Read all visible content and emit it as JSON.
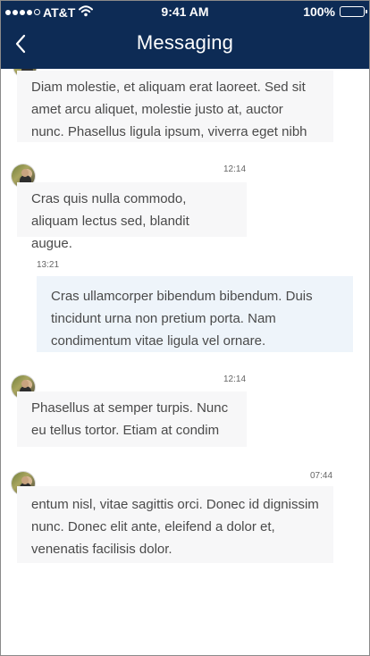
{
  "status_bar": {
    "carrier": "AT&T",
    "time": "9:41 AM",
    "battery_text": "100%",
    "battery_level": 1
  },
  "header": {
    "title": "Messaging"
  },
  "messages": [
    {
      "direction": "incoming",
      "time": "",
      "text": "Diam molestie, et aliquam erat laoreet. Sed sit amet arcu aliquet, molestie justo at, auctor nunc. Phasellus ligula ipsum, viverra eget nibh"
    },
    {
      "direction": "incoming",
      "time": "12:14",
      "text": "Cras quis nulla commodo, aliquam lectus sed, blandit augue."
    },
    {
      "direction": "outgoing",
      "time": "13:21",
      "text": "Cras ullamcorper bibendum bibendum. Duis tincidunt urna non pretium porta. Nam condimentum vitae ligula vel ornare."
    },
    {
      "direction": "incoming",
      "time": "12:14",
      "text": "Phasellus at semper turpis. Nunc eu tellus tortor. Etiam at condim"
    },
    {
      "direction": "incoming",
      "time": "07:44",
      "text": "entum nisl, vitae sagittis orci. Donec id dignissim nunc. Donec elit ante, eleifend a dolor et, venenatis facilisis dolor."
    }
  ],
  "icons": {
    "back": "chevron-left-icon",
    "wifi": "wifi-icon",
    "battery": "battery-icon",
    "signal": "signal-icon"
  },
  "colors": {
    "header_bg": "#0d2b55",
    "incoming_bubble": "#f7f7f8",
    "outgoing_bubble": "#eef4fa",
    "message_text": "#4a4a4a"
  }
}
